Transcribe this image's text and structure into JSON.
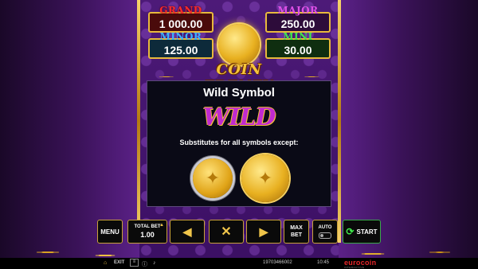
{
  "jackpots": {
    "grand": {
      "label": "GRAND",
      "value": "1 000.00"
    },
    "major": {
      "label": "MAJOR",
      "value": "250.00"
    },
    "minor": {
      "label": "MINOR",
      "value": "125.00"
    },
    "mini": {
      "label": "MINI",
      "value": "30.00"
    }
  },
  "game": {
    "logo": "COIN FRENZY"
  },
  "info_panel": {
    "title": "Wild Symbol",
    "wild_text": "WILD",
    "description": "Substitutes for all symbols except:"
  },
  "controls": {
    "menu": "MENU",
    "total_bet_label": "TOTAL BET",
    "total_bet_value": "1.00",
    "prev_icon": "◀",
    "close_icon": "✕",
    "next_icon": "▶",
    "max_bet": "MAX BET",
    "auto": "AUTO",
    "start": "START"
  },
  "status": {
    "exit": "EXIT",
    "session_id": "19703466002",
    "time": "10:45",
    "brand": "eurocoin",
    "brand_sub": "INTERACTIVE"
  },
  "colors": {
    "grand": "#ff2a2a",
    "major": "#e050e8",
    "minor": "#3ab4ff",
    "mini": "#3ee84a",
    "gold": "#f0c54a"
  }
}
